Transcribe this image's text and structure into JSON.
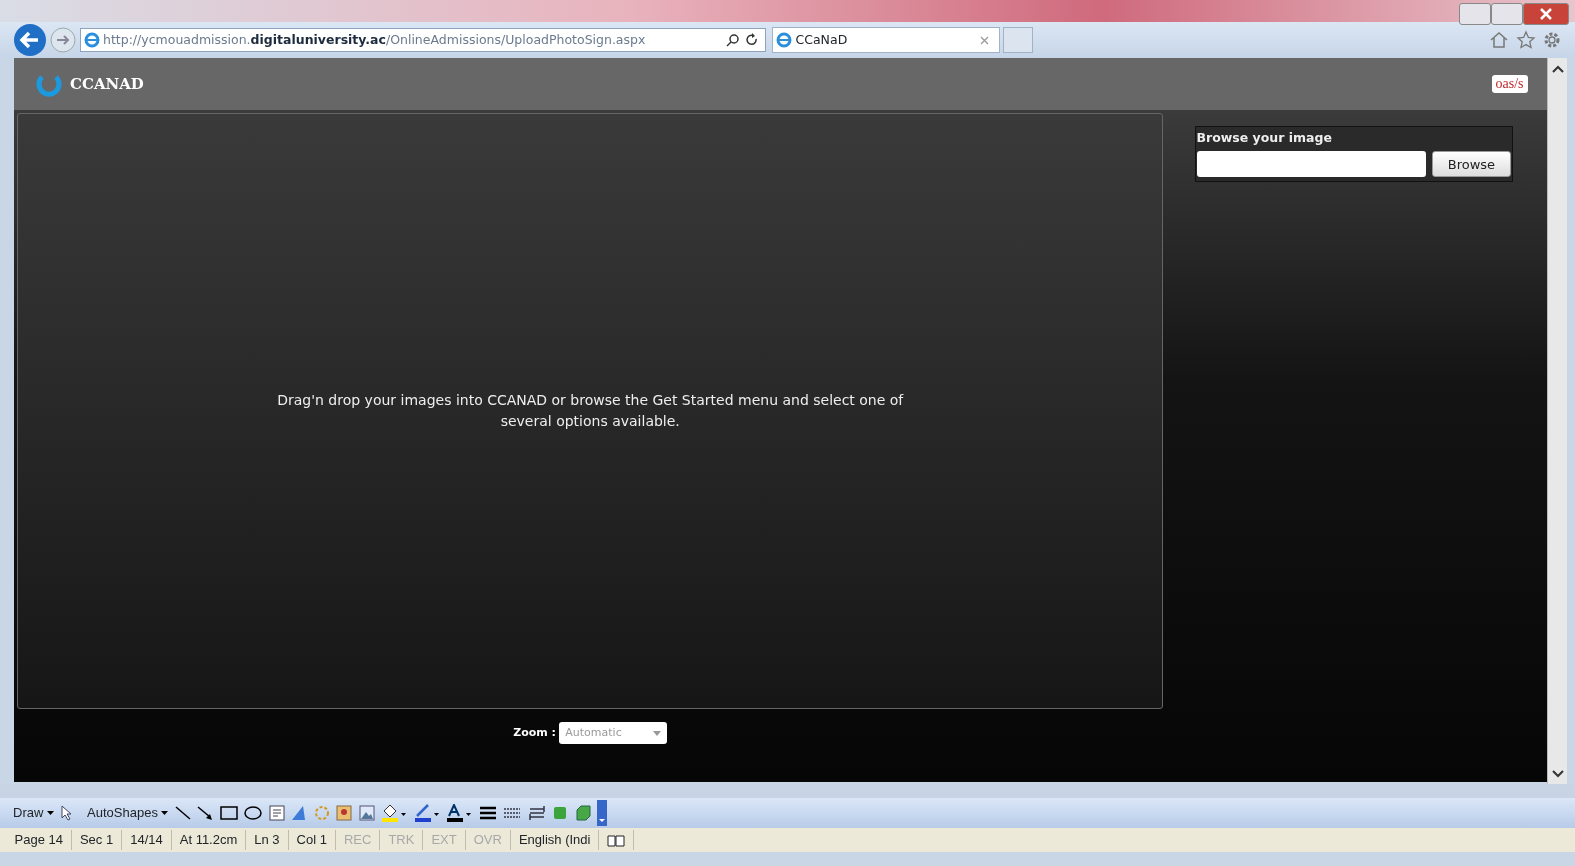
{
  "browser": {
    "url": "http://ycmouadmission.**digitaluniversity.ac**/OnlineAdmissions/UploadPhotoSign.aspx",
    "tabs": [
      {
        "title": "CCaNaD",
        "selected": true
      }
    ]
  },
  "app": {
    "brand": "CCANAD",
    "logo": "oas/s"
  },
  "drop_area": {
    "message": "Drag'n drop your images into CCANAD or browse the Get Started menu and select one of several options available."
  },
  "browse_panel": {
    "title": "Browse your image",
    "button": "Browse"
  },
  "zoom": {
    "label": "Zoom :",
    "value": "Automatic"
  },
  "drawing_toolbar": {
    "draw": "Draw",
    "autoshapes": "AutoShapes"
  },
  "status_bar": [
    {
      "text": "Page 14",
      "disabled": false
    },
    {
      "text": "Sec 1",
      "disabled": false
    },
    {
      "text": "14/14",
      "disabled": false
    },
    {
      "text": "At 11.2cm",
      "disabled": false
    },
    {
      "text": "Ln 3",
      "disabled": false
    },
    {
      "text": "Col 1",
      "disabled": false
    },
    {
      "text": "REC",
      "disabled": true
    },
    {
      "text": "TRK",
      "disabled": true
    },
    {
      "text": "EXT",
      "disabled": true
    },
    {
      "text": "OVR",
      "disabled": true
    },
    {
      "text": "English (Indi",
      "disabled": false
    }
  ]
}
